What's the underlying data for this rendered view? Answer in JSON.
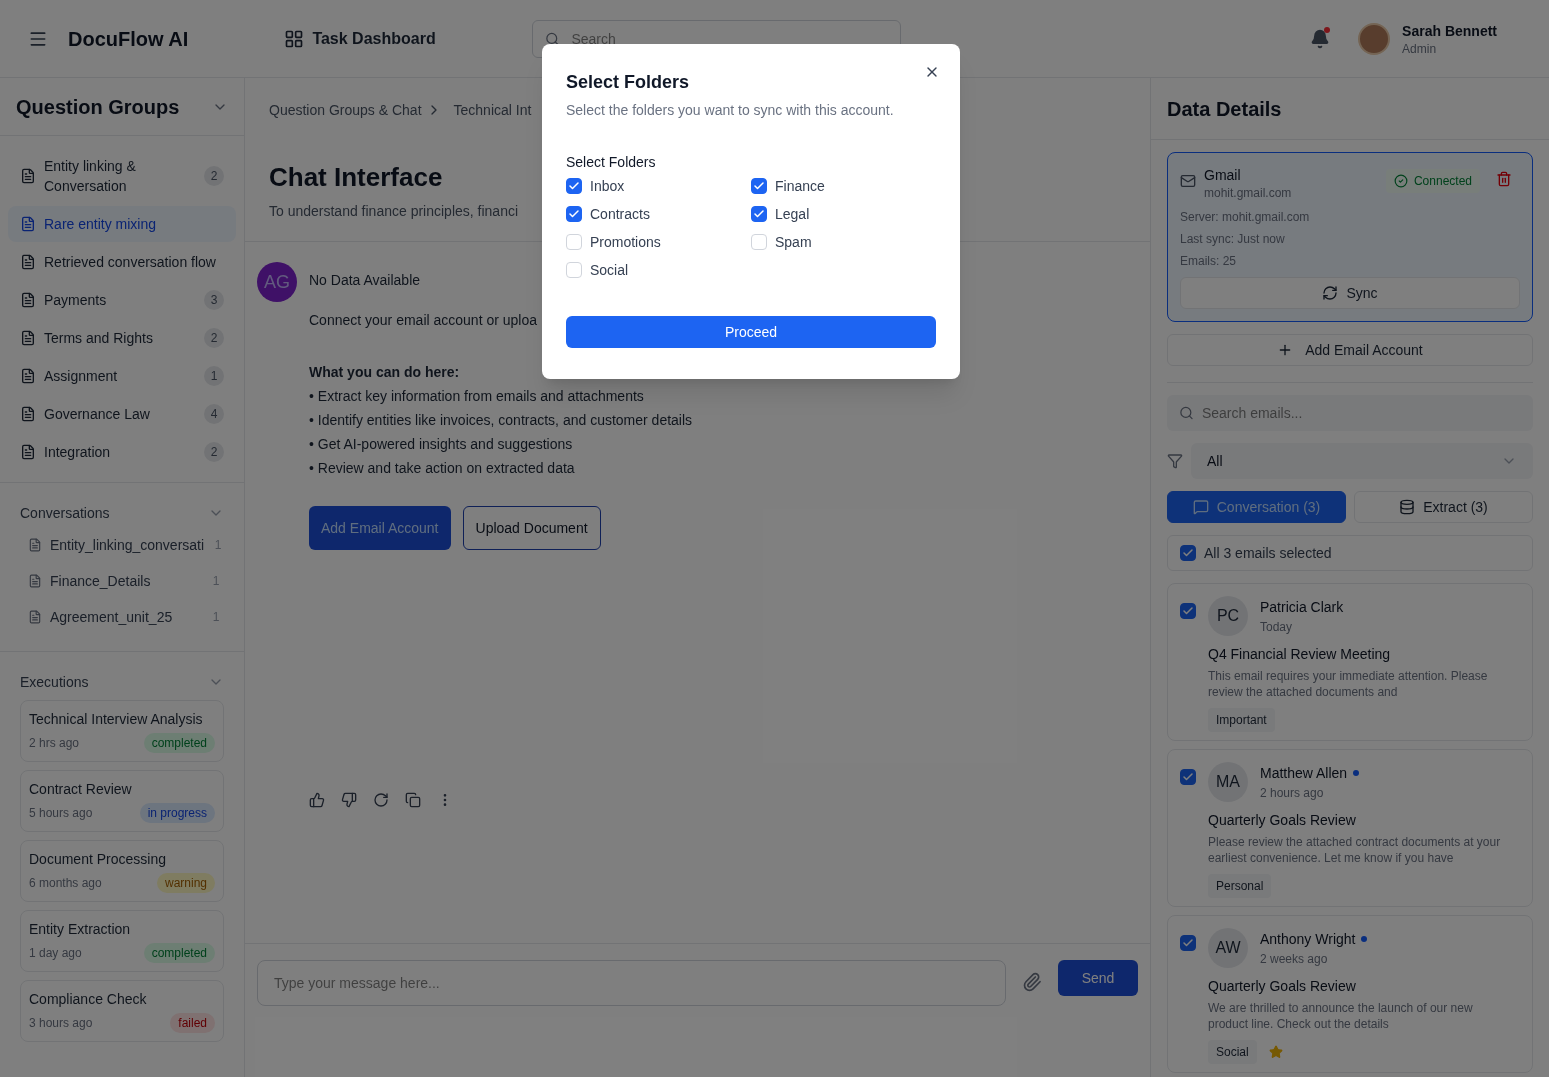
{
  "header": {
    "app_name": "DocuFlow AI",
    "nav_link": "Task Dashboard",
    "search": {
      "placeholder": "Search"
    },
    "user": {
      "name": "Sarah Bennett",
      "role": "Admin"
    }
  },
  "sidebar": {
    "title": "Question Groups",
    "groups": [
      {
        "label": "Entity linking & Conversation",
        "count": "2",
        "selected": false
      },
      {
        "label": "Rare entity mixing",
        "selected": true
      },
      {
        "label": "Retrieved conversation flow",
        "selected": false
      },
      {
        "label": "Payments",
        "count": "3",
        "selected": false
      },
      {
        "label": "Terms and Rights",
        "count": "2",
        "selected": false
      },
      {
        "label": "Assignment",
        "count": "1",
        "selected": false
      },
      {
        "label": "Governance Law",
        "count": "4",
        "selected": false
      },
      {
        "label": "Integration",
        "count": "2",
        "selected": false
      }
    ],
    "conversations": {
      "title": "Conversations",
      "items": [
        {
          "label": "Entity_linking_conversati",
          "count": "1"
        },
        {
          "label": "Finance_Details",
          "count": "1"
        },
        {
          "label": "Agreement_unit_25",
          "count": "1"
        }
      ]
    },
    "executions": {
      "title": "Executions",
      "items": [
        {
          "title": "Technical Interview Analysis",
          "time": "2 hrs ago",
          "status": "completed",
          "kind": "completed"
        },
        {
          "title": "Contract Review",
          "time": "5 hours ago",
          "status": "in progress",
          "kind": "progress"
        },
        {
          "title": "Document Processing",
          "time": "6 months ago",
          "status": "warning",
          "kind": "warning"
        },
        {
          "title": "Entity Extraction",
          "time": "1 day ago",
          "status": "completed",
          "kind": "completed"
        },
        {
          "title": "Compliance Check",
          "time": "3 hours ago",
          "status": "failed",
          "kind": "failed"
        }
      ]
    }
  },
  "main": {
    "breadcrumb": [
      "Question Groups & Chat",
      "Technical Int"
    ],
    "title": "Chat Interface",
    "subtitle": "To understand finance principles, financi",
    "message": {
      "avatar": "AG",
      "heading": "No Data Available",
      "intro": "Connect your email account or uploa",
      "list_title": "What you can do here:",
      "bullets": [
        "• Extract key information from emails and attachments",
        "• Identify entities like invoices, contracts, and customer details",
        "• Get AI-powered insights and suggestions",
        "• Review and take action on extracted data"
      ],
      "buttons": [
        "Add Email Account",
        "Upload Document"
      ]
    },
    "composer": {
      "placeholder": "Type your message here...",
      "send": "Send"
    }
  },
  "details": {
    "title": "Data Details",
    "account": {
      "provider": "Gmail",
      "email": "mohit.gmail.com",
      "status": "Connected",
      "lines": [
        "Server: mohit.gmail.com",
        "Last sync: Just now",
        "Emails: 25"
      ],
      "sync": "Sync"
    },
    "add_account": "Add Email Account",
    "search": {
      "placeholder": "Search emails..."
    },
    "filter": "All",
    "tabs": [
      {
        "label": "Conversation (3)",
        "selected": true
      },
      {
        "label": "Extract (3)",
        "selected": false
      }
    ],
    "select_all": {
      "label": "All 3 emails selected",
      "checked": true
    },
    "emails": [
      {
        "checked": true,
        "initials": "PC",
        "sender": "Patricia Clark",
        "unread": false,
        "time": "Today",
        "subject": "Q4 Financial Review Meeting",
        "preview": "This email requires your immediate attention. Please review the attached documents and",
        "tag": "Important",
        "starred": false
      },
      {
        "checked": true,
        "initials": "MA",
        "sender": "Matthew Allen",
        "unread": true,
        "time": "2 hours ago",
        "subject": "Quarterly Goals Review",
        "preview": "Please review the attached contract documents at your earliest convenience. Let me know if you have",
        "tag": "Personal",
        "starred": false
      },
      {
        "checked": true,
        "initials": "AW",
        "sender": "Anthony Wright",
        "unread": true,
        "time": "2 weeks ago",
        "subject": "Quarterly Goals Review",
        "preview": "We are thrilled to announce the launch of our new product line. Check out the details",
        "tag": "Social",
        "starred": true
      }
    ]
  },
  "dialog": {
    "title": "Select Folders",
    "description": "Select the folders you want to sync with this account.",
    "group_label": "Select Folders",
    "folders": [
      {
        "label": "Inbox",
        "checked": true
      },
      {
        "label": "Finance",
        "checked": true
      },
      {
        "label": "Contracts",
        "checked": true
      },
      {
        "label": "Legal",
        "checked": true
      },
      {
        "label": "Promotions",
        "checked": false
      },
      {
        "label": "Spam",
        "checked": false
      },
      {
        "label": "Social",
        "checked": false
      }
    ],
    "proceed": "Proceed"
  }
}
